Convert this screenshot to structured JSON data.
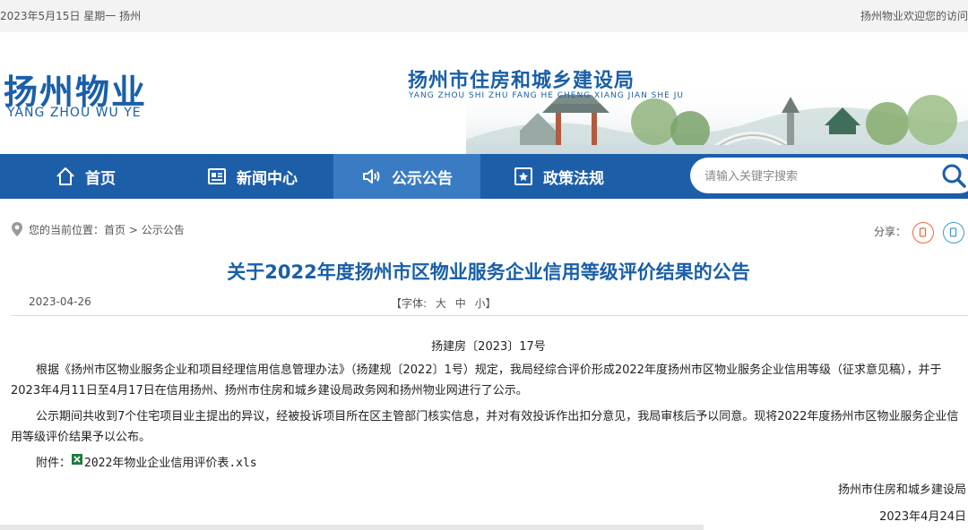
{
  "topbar": {
    "date": "2023年5月15日 星期一 扬州",
    "welcome": "扬州物业欢迎您的访问"
  },
  "header": {
    "logo_cn": "扬州物业",
    "logo_en": "YANG ZHOU WU YE",
    "bureau_cn": "扬州市住房和城乡建设局",
    "bureau_en": "YANG ZHOU SHI ZHU FANG HE CHENG XIANG JIAN SHE JU"
  },
  "nav": {
    "items": [
      {
        "label": "首页",
        "icon": "home-icon"
      },
      {
        "label": "新闻中心",
        "icon": "news-icon"
      },
      {
        "label": "公示公告",
        "icon": "speaker-icon",
        "active": true
      },
      {
        "label": "政策法规",
        "icon": "policy-icon"
      }
    ]
  },
  "search": {
    "placeholder": "请输入关键字搜索",
    "value": "",
    "icon": "search-icon"
  },
  "breadcrumb": {
    "prefix": "您的当前位置：",
    "home": "首页",
    "sep": " > ",
    "current": "公示公告"
  },
  "share": {
    "label": "分享："
  },
  "article": {
    "title": "关于2022年度扬州市区物业服务企业信用等级评价结果的公告",
    "date": "2023-04-26",
    "font_label": "【字体:",
    "font_large": "大",
    "font_medium": "中",
    "font_small": "小",
    "font_close": "】",
    "doc_no": "扬建房〔2023〕17号",
    "para1": "根据《扬州市区物业服务企业和项目经理信用信息管理办法》（扬建规〔2022〕1号）规定，我局经综合评价形成2022年度扬州市区物业服务企业信用等级（征求意见稿），并于2023年4月11日至4月17日在信用扬州、扬州市住房和城乡建设局政务网和扬州物业网进行了公示。",
    "para2": "公示期间共收到7个住宅项目业主提出的异议，经被投诉项目所在区主管部门核实信息，并对有效投诉作出扣分意见，我局审核后予以同意。现将2022年度扬州市区物业服务企业信用等级评价结果予以公布。",
    "attach_label": "附件：",
    "attach_file": "2022年物业企业信用评价表.xls",
    "sign_org": "扬州市住房和城乡建设局",
    "sign_date": "2023年4月24日"
  },
  "colors": {
    "brand": "#1d5ea9",
    "nav_active": "#3a7cc4",
    "title": "#1a5fa8",
    "share": "#e86a3c"
  }
}
